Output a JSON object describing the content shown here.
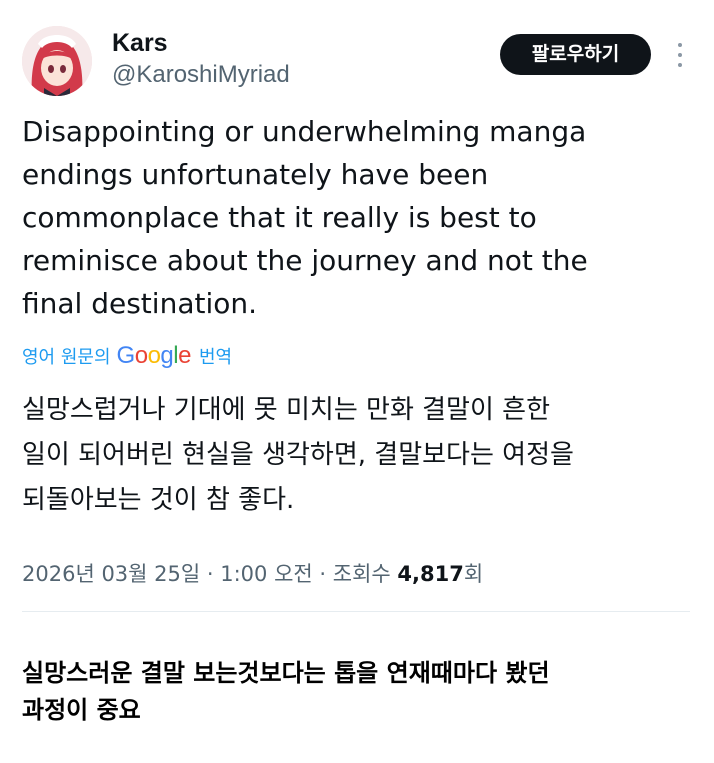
{
  "author": {
    "name": "Kars",
    "handle": "@KaroshiMyriad"
  },
  "follow_button_label": "팔로우하기",
  "more_icon": "more-vertical-icon",
  "tweet_text": "Disappointing or underwhelming manga\nendings unfortunately have been\ncommonplace that it really is best to\nreminisce about the journey and not the\nfinal destination.",
  "translate": {
    "prefix": "영어 원문의",
    "logo_letters": [
      "G",
      "o",
      "o",
      "g",
      "l",
      "e"
    ],
    "suffix": "번역"
  },
  "translated_text": "실망스럽거나 기대에 못 미치는 만화 결말이 흔한\n일이 되어버린 현실을 생각하면, 결말보다는 여정을\n되돌아보는 것이 참 좋다.",
  "meta": {
    "date": "2026년 03월 25일",
    "separator1": " · ",
    "time": "1:00 오전",
    "separator2": " · ",
    "views_label": "조회수 ",
    "views_count": "4,817",
    "views_suffix": "회"
  },
  "caption": "실망스러운 결말 보는것보다는 톱을 연재때마다 봤던\n과정이 중요",
  "colors": {
    "link": "#1d9bf0",
    "secondary_text": "#536471",
    "follow_button_bg": "#0f1419"
  }
}
